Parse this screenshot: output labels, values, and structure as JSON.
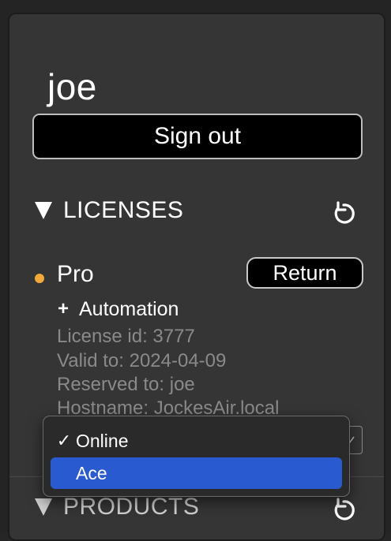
{
  "user": {
    "name": "joe",
    "sign_out_label": "Sign out"
  },
  "licenses_section": {
    "title": "LICENSES",
    "license": {
      "name": "Pro",
      "status_color": "#f0a93a",
      "return_label": "Return",
      "addon_label": "Automation",
      "details": [
        "License id: 3777",
        "Valid to: 2024-04-09",
        "Reserved to: joe",
        "Hostname: JockesAir.local"
      ]
    }
  },
  "products_section": {
    "title": "PRODUCTS"
  },
  "dropdown": {
    "options": [
      {
        "label": "Online",
        "checked": true,
        "highlighted": false
      },
      {
        "label": "Ace",
        "checked": false,
        "highlighted": true
      }
    ]
  },
  "colors": {
    "background": "#242424",
    "panel": "#353535",
    "highlight": "#2a5ad0",
    "detail_text": "#8a8a8a"
  }
}
